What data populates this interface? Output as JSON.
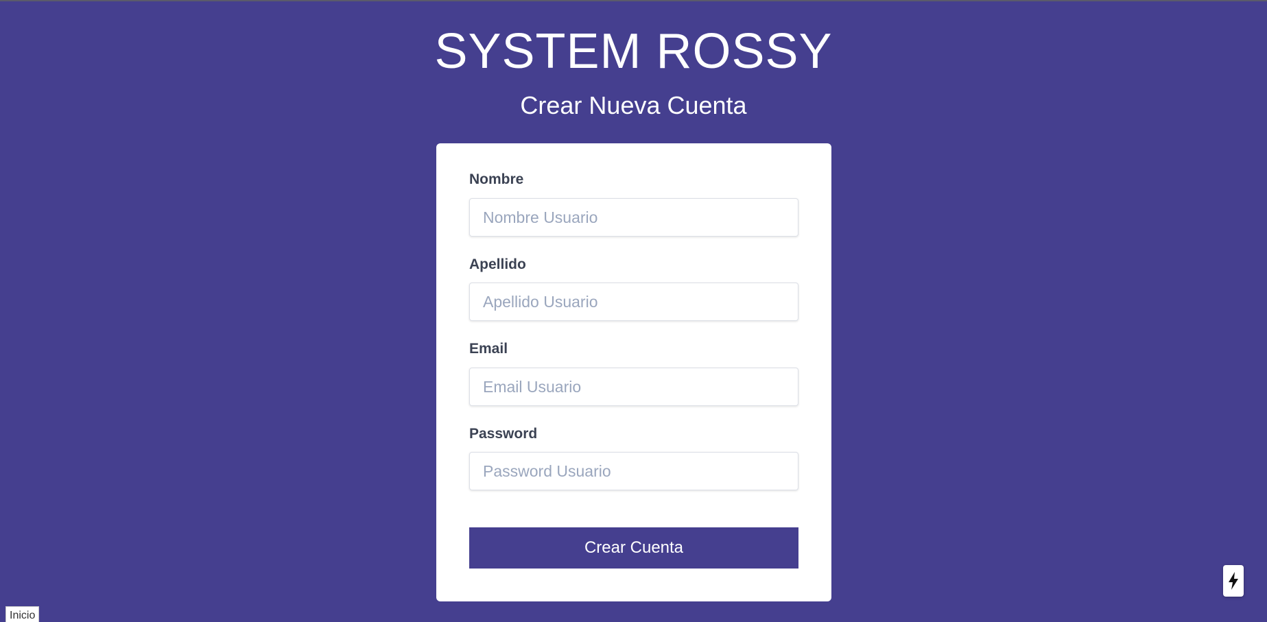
{
  "header": {
    "title": "SYSTEM ROSSY",
    "subtitle": "Crear Nueva Cuenta"
  },
  "form": {
    "fields": [
      {
        "label": "Nombre",
        "placeholder": "Nombre Usuario",
        "value": ""
      },
      {
        "label": "Apellido",
        "placeholder": "Apellido Usuario",
        "value": ""
      },
      {
        "label": "Email",
        "placeholder": "Email Usuario",
        "value": ""
      },
      {
        "label": "Password",
        "placeholder": "Password Usuario",
        "value": ""
      }
    ],
    "submit_label": "Crear Cuenta"
  },
  "status_bar": {
    "link_text": "Inicio"
  },
  "icons": {
    "floating_button": "lightning-bolt-icon"
  },
  "colors": {
    "background": "#453f8f",
    "card": "#ffffff",
    "button": "#453f8f",
    "label_text": "#3b4253",
    "placeholder_text": "#9aa6bd"
  }
}
